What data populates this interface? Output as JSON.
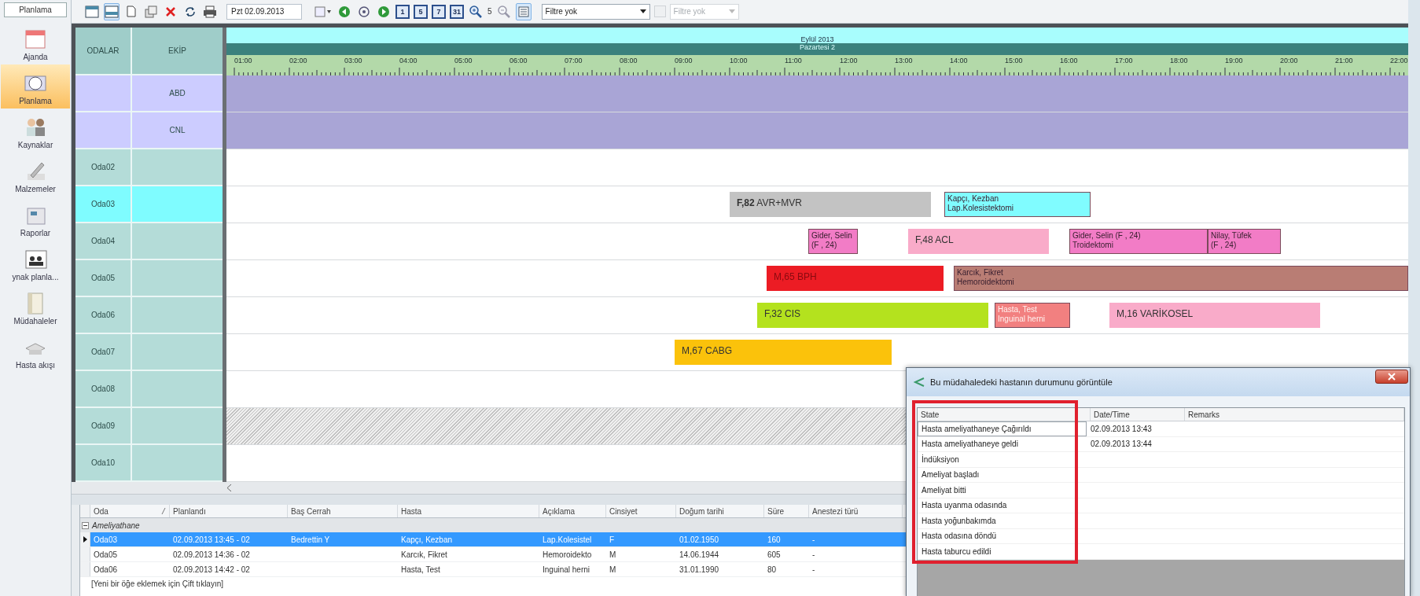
{
  "sidebar": {
    "tab": "Planlama",
    "items": [
      {
        "label": "Ajanda",
        "selected": false
      },
      {
        "label": "Planlama",
        "selected": true
      },
      {
        "label": "Kaynaklar",
        "selected": false
      },
      {
        "label": "Malzemeler",
        "selected": false
      },
      {
        "label": "Raporlar",
        "selected": false
      },
      {
        "label": "ynak planla...",
        "selected": false
      },
      {
        "label": "Müdahaleler",
        "selected": false
      },
      {
        "label": "Hasta akışı",
        "selected": false
      }
    ]
  },
  "toolbar": {
    "layouts": [
      {
        "selected": false
      },
      {
        "selected": true
      }
    ],
    "date": "Pzt 02.09.2013",
    "day_views": [
      {
        "label": "1",
        "selected": false
      },
      {
        "label": "5",
        "selected": false
      },
      {
        "label": "7",
        "selected": false
      },
      {
        "label": "31",
        "selected": false
      }
    ],
    "zoom": "5",
    "list_view_selected": true,
    "filters": [
      {
        "value": "Filtre yok",
        "disabled": false
      },
      {
        "value": "Filtre yok",
        "disabled": true
      }
    ]
  },
  "scheduler": {
    "columns": [
      "ODALAR",
      "EKİP"
    ],
    "month": "Eylül 2013",
    "day": "Pazartesi 2",
    "hours": [
      "01:00",
      "02:00",
      "03:00",
      "04:00",
      "05:00",
      "06:00",
      "07:00",
      "08:00",
      "09:00",
      "10:00",
      "11:00",
      "12:00",
      "13:00",
      "14:00",
      "15:00",
      "16:00",
      "17:00",
      "18:00",
      "19:00",
      "20:00",
      "21:00",
      "22:00"
    ],
    "rows": [
      {
        "kind": "team",
        "team": "ABD",
        "selected": false,
        "blocked": false
      },
      {
        "kind": "team",
        "team": "CNL",
        "selected": false,
        "blocked": false
      },
      {
        "kind": "room",
        "room": "Oda02",
        "selected": false,
        "blocked": false
      },
      {
        "kind": "room",
        "room": "Oda03",
        "selected": true,
        "blocked": false,
        "blocks": [
          {
            "kind": "label",
            "text": "**F,82**  AVR+MVR",
            "color": "#c3c3c3"
          },
          {
            "kind": "patient",
            "name": "Kapçı, Kezban",
            "procedure": "Lap.Kolesistektomi",
            "color": "#80fcff"
          }
        ]
      },
      {
        "kind": "room",
        "room": "Oda04",
        "selected": false,
        "blocked": false,
        "blocks": [
          {
            "kind": "patient",
            "name": "Gider, Selin",
            "procedure": "(F , 24)",
            "color": "#f27cc6"
          },
          {
            "kind": "label",
            "text": "F,48 ACL",
            "color": "#f9abc9"
          },
          {
            "kind": "patient",
            "name": "Gider, Selin (F , 24)",
            "procedure": "Troidektomi",
            "color": "#f27cc6"
          },
          {
            "kind": "patient",
            "name": "Nilay, Tüfek",
            "procedure": "(F , 24)",
            "color": "#f27cc6"
          }
        ]
      },
      {
        "kind": "room",
        "room": "Oda05",
        "selected": false,
        "blocked": false,
        "blocks": [
          {
            "kind": "label",
            "text": "M,65 BPH",
            "color": "#ec1c24"
          },
          {
            "kind": "patient",
            "name": "Karcık, Fikret",
            "procedure": "Hemoroidektomi",
            "color": "#b97d74"
          }
        ]
      },
      {
        "kind": "room",
        "room": "Oda06",
        "selected": false,
        "blocked": false,
        "blocks": [
          {
            "kind": "label",
            "text": "F,32 CIS",
            "color": "#b4e21e"
          },
          {
            "kind": "patient",
            "name": "Hasta, Test",
            "procedure": "Inguinal herni",
            "color": "#f28080"
          },
          {
            "kind": "label",
            "text": "M,16 VARİKOSEL",
            "color": "#f9abc9"
          }
        ]
      },
      {
        "kind": "room",
        "room": "Oda07",
        "selected": false,
        "blocked": false,
        "blocks": [
          {
            "kind": "label",
            "text": "M,67 CABG",
            "color": "#fbc20b"
          }
        ]
      },
      {
        "kind": "room",
        "room": "Oda08",
        "selected": false,
        "blocked": false
      },
      {
        "kind": "room",
        "room": "Oda09",
        "selected": false,
        "blocked": true
      },
      {
        "kind": "room",
        "room": "Oda10",
        "selected": false,
        "blocked": false
      }
    ]
  },
  "grid": {
    "columns": [
      {
        "label": "Oda",
        "sorted": true
      },
      {
        "label": "Planlandı",
        "sorted": false
      },
      {
        "label": "Baş Cerrah",
        "sorted": false
      },
      {
        "label": "Hasta",
        "sorted": false
      },
      {
        "label": "Açıklama",
        "sorted": false
      },
      {
        "label": "Cinsiyet",
        "sorted": false
      },
      {
        "label": "Doğum tarihi",
        "sorted": false
      },
      {
        "label": "Süre",
        "sorted": false
      },
      {
        "label": "Anestezi türü",
        "sorted": false
      }
    ],
    "group": {
      "label": "Ameliyathane",
      "expanded": true
    },
    "rows": [
      {
        "selected": true,
        "cells": [
          "Oda03",
          "02.09.2013 13:45 - 02",
          "Bedrettin Y",
          "Kapçı, Kezban",
          "Lap.Kolesistel",
          "F",
          "01.02.1950",
          "160",
          "-"
        ]
      },
      {
        "selected": false,
        "cells": [
          "Oda05",
          "02.09.2013 14:36 - 02",
          "",
          "Karcık, Fikret",
          "Hemoroidekto",
          "M",
          "14.06.1944",
          "605",
          "-"
        ]
      },
      {
        "selected": false,
        "cells": [
          "Oda06",
          "02.09.2013 14:42 - 02",
          "",
          "Hasta, Test",
          "Inguinal herni",
          "M",
          "31.01.1990",
          "80",
          "-"
        ]
      }
    ],
    "new_row_hint": "[Yeni bir öğe eklemek için Çift tıklayın]"
  },
  "dialog": {
    "title": "Bu müdahaledeki hastanın durumunu görüntüle",
    "columns": [
      "State",
      "Date/Time",
      "Remarks"
    ],
    "state_column_highlighted": true,
    "rows": [
      {
        "state": "Hasta ameliyathaneye Çağırıldı",
        "time": "02.09.2013 13:43",
        "selected": true
      },
      {
        "state": "Hasta ameliyathaneye geldi",
        "time": "02.09.2013 13:44",
        "selected": false
      },
      {
        "state": "İndüksiyon",
        "selected": false
      },
      {
        "state": "Ameliyat başladı",
        "selected": false
      },
      {
        "state": "Ameliyat bitti",
        "selected": false
      },
      {
        "state": "Hasta uyanma odasında",
        "selected": false
      },
      {
        "state": "Hasta yoğunbakımda",
        "selected": false
      },
      {
        "state": "Hasta odasına döndü",
        "selected": false
      },
      {
        "state": "Hasta taburcu edildi",
        "selected": false
      }
    ]
  }
}
